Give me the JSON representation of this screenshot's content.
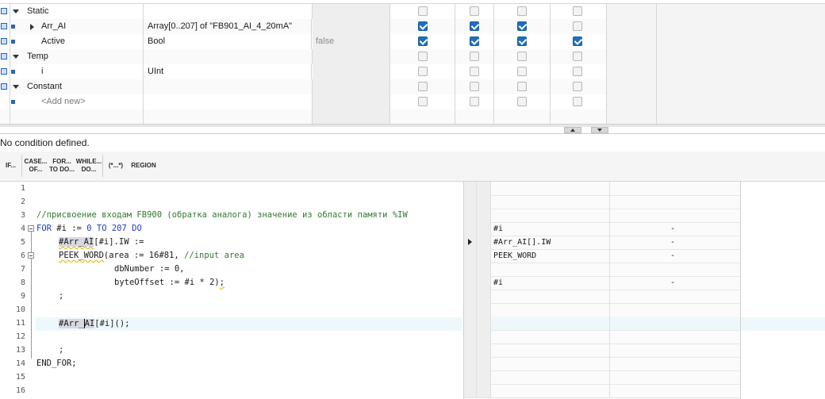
{
  "interface": {
    "rows": [
      {
        "name": "Static",
        "type": "",
        "default": "",
        "checks": [
          false,
          false,
          false,
          false
        ],
        "section": true
      },
      {
        "name": "Arr_AI",
        "type": "Array[0..207] of \"FB901_AI_4_20mA\"",
        "default": "",
        "checks": [
          true,
          true,
          true,
          false
        ]
      },
      {
        "name": "Active",
        "type": "Bool",
        "default": "false",
        "checks": [
          true,
          true,
          true,
          true
        ]
      },
      {
        "name": "Temp",
        "type": "",
        "default": "",
        "checks": [
          false,
          false,
          false,
          false
        ],
        "section": true
      },
      {
        "name": "i",
        "type": "UInt",
        "default": "",
        "checks": [
          false,
          false,
          false,
          false
        ]
      },
      {
        "name": "Constant",
        "type": "",
        "default": "",
        "checks": [
          false,
          false,
          false,
          false
        ],
        "section": true
      },
      {
        "name": "<Add new>",
        "type": "",
        "default": "",
        "checks": [
          false,
          false,
          false,
          false
        ],
        "placeholder": true
      }
    ]
  },
  "condition": {
    "text": "No condition defined."
  },
  "toolbar": {
    "buttons": [
      {
        "label": "IF..."
      },
      {
        "label": "CASE...\nOF..."
      },
      {
        "label": "FOR...\nTO DO..."
      },
      {
        "label": "WHILE...\nDO..."
      },
      {
        "label": "(*...*)"
      },
      {
        "label": "REGION"
      }
    ]
  },
  "editor": {
    "line_numbers": [
      "1",
      "2",
      "3",
      "4",
      "5",
      "6",
      "7",
      "8",
      "9",
      "10",
      "11",
      "12",
      "13",
      "14",
      "15",
      "16"
    ],
    "comment": "//присвоение входам FB900 (обратка аналога) значение из области памяти %IW",
    "line4": {
      "kw1": "FOR",
      "var": " #i := ",
      "num1": "0",
      "kw2": " TO ",
      "num2": "207",
      "kw3": " DO"
    },
    "line5": {
      "ref": "#Arr_AI",
      "rest": "[#i].IW :="
    },
    "line6": {
      "fn": "PEEK_WORD",
      "args": "(area := 16#81, ",
      "cmt": "//input area"
    },
    "line7": "dbNumber := 0,",
    "line8": {
      "text": "byteOffset := #i * 2)",
      "end": ";"
    },
    "line9": ";",
    "line11": {
      "pre": "#Arr_",
      "post": "AI",
      "rest": "[#i]();"
    },
    "line13": ";",
    "line14": "END_FOR;"
  },
  "watch": {
    "rows": [
      {
        "name": "",
        "value": "",
        "line": "3"
      },
      {
        "name": "#i",
        "value": "-",
        "line": "4"
      },
      {
        "name": "#Arr_AI[].IW",
        "value": "-",
        "line": "5",
        "pointer": true
      },
      {
        "name": "PEEK_WORD",
        "value": "-",
        "line": "6"
      },
      {
        "name": "",
        "value": "",
        "line": "7"
      },
      {
        "name": "#i",
        "value": "-",
        "line": "8"
      }
    ]
  }
}
